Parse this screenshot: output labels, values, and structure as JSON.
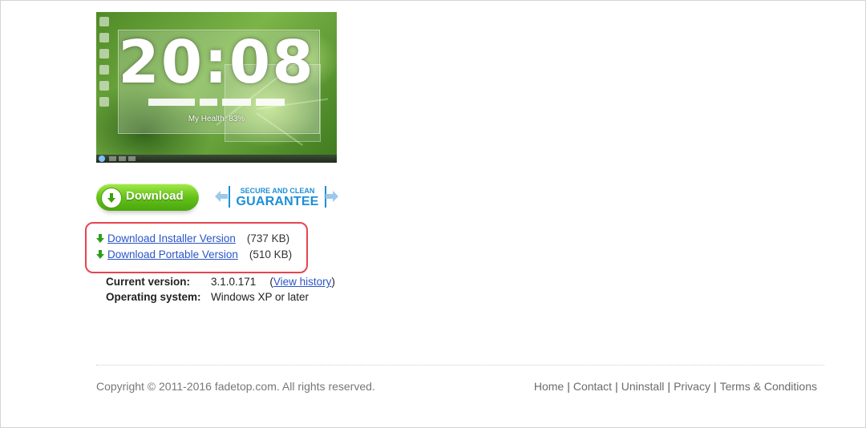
{
  "preview": {
    "clock_text": "20:08",
    "health_text": "My Health: 83%"
  },
  "download_button": {
    "label": "Download"
  },
  "guarantee": {
    "line1": "SECURE AND CLEAN",
    "line2": "GUARANTEE"
  },
  "downloads": [
    {
      "label": "Download Installer Version",
      "size": "(737 KB)"
    },
    {
      "label": "Download Portable Version",
      "size": "(510 KB)"
    }
  ],
  "info": {
    "current_version_label": "Current version:",
    "current_version_value": "3.1.0.171",
    "view_history_open": "(",
    "view_history_label": "View history",
    "view_history_close": ")",
    "os_label": "Operating system:",
    "os_value": "Windows XP or later"
  },
  "footer": {
    "copyright": "Copyright © 2011-2016 fadetop.com. All rights reserved.",
    "links": [
      "Home",
      "Contact",
      "Uninstall",
      "Privacy",
      "Terms & Conditions"
    ],
    "separator": "|"
  },
  "colors": {
    "link": "#2b55c8",
    "highlight_border": "#e64550",
    "download_green": "#66c21a",
    "guarantee_blue": "#1d8fd6"
  }
}
